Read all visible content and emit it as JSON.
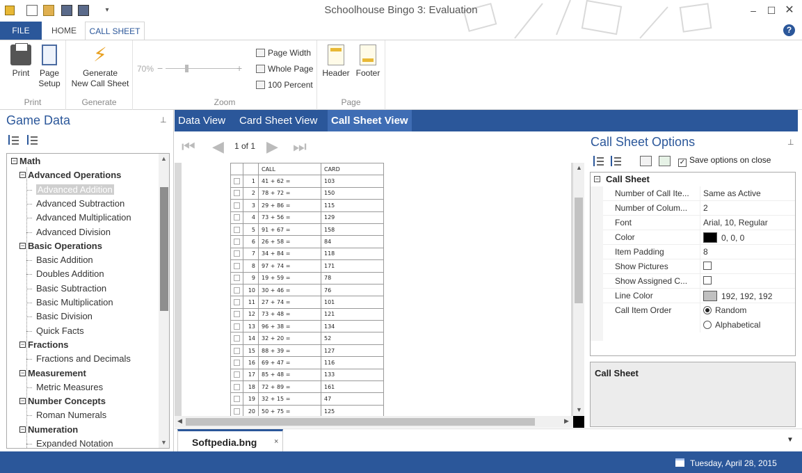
{
  "window": {
    "title": "Schoolhouse Bingo 3: Evaluation",
    "min_glyph": "–",
    "max_glyph": "☐",
    "close_glyph": "✕",
    "quick_more_glyph": "▾"
  },
  "menu": {
    "file": "FILE",
    "home": "HOME",
    "call_sheet": "CALL SHEET",
    "help": "?"
  },
  "ribbon": {
    "print_group": "Print",
    "print": "Print",
    "page_setup_1": "Page",
    "page_setup_2": "Setup",
    "generate_group": "Generate",
    "generate_1": "Generate",
    "generate_2": "New Call Sheet",
    "zoom_group": "Zoom",
    "zoom_pct": "70%",
    "zoom_minus": "−",
    "zoom_plus": "+",
    "page_width": "Page Width",
    "whole_page": "Whole Page",
    "hundred": "100 Percent",
    "page_group": "Page",
    "header": "Header",
    "footer": "Footer"
  },
  "game_data": {
    "title": "Game Data",
    "pin": "📌",
    "tree": [
      {
        "label": "Math",
        "level": 0
      },
      {
        "label": "Advanced Operations",
        "level": 1
      },
      {
        "label": "Advanced Addition",
        "level": 2,
        "selected": true
      },
      {
        "label": "Advanced Subtraction",
        "level": 2
      },
      {
        "label": "Advanced Multiplication",
        "level": 2
      },
      {
        "label": "Advanced Division",
        "level": 2
      },
      {
        "label": "Basic Operations",
        "level": 1
      },
      {
        "label": "Basic Addition",
        "level": 2
      },
      {
        "label": "Doubles Addition",
        "level": 2
      },
      {
        "label": "Basic Subtraction",
        "level": 2
      },
      {
        "label": "Basic Multiplication",
        "level": 2
      },
      {
        "label": "Basic Division",
        "level": 2
      },
      {
        "label": "Quick Facts",
        "level": 2
      },
      {
        "label": "Fractions",
        "level": 1
      },
      {
        "label": "Fractions and Decimals",
        "level": 2
      },
      {
        "label": "Measurement",
        "level": 1
      },
      {
        "label": "Metric Measures",
        "level": 2
      },
      {
        "label": "Number Concepts",
        "level": 1
      },
      {
        "label": "Roman Numerals",
        "level": 2
      },
      {
        "label": "Numeration",
        "level": 1
      },
      {
        "label": "Expanded Notation",
        "level": 2
      }
    ]
  },
  "view_tabs": {
    "data": "Data View",
    "card": "Card Sheet View",
    "call": "Call Sheet View"
  },
  "viewer": {
    "page_of": "1 of 1",
    "col_call": "CALL",
    "col_card": "CARD",
    "rows": [
      {
        "n": "1",
        "call": "41 + 62 =",
        "card": "103"
      },
      {
        "n": "2",
        "call": "78 + 72 =",
        "card": "150"
      },
      {
        "n": "3",
        "call": "29 + 86 =",
        "card": "115"
      },
      {
        "n": "4",
        "call": "73 + 56 =",
        "card": "129"
      },
      {
        "n": "5",
        "call": "91 + 67 =",
        "card": "158"
      },
      {
        "n": "6",
        "call": "26 + 58 =",
        "card": "84"
      },
      {
        "n": "7",
        "call": "34 + 84 =",
        "card": "118"
      },
      {
        "n": "8",
        "call": "97 + 74 =",
        "card": "171"
      },
      {
        "n": "9",
        "call": "19 + 59 =",
        "card": "78"
      },
      {
        "n": "10",
        "call": "30 + 46 =",
        "card": "76"
      },
      {
        "n": "11",
        "call": "27 + 74 =",
        "card": "101"
      },
      {
        "n": "12",
        "call": "73 + 48 =",
        "card": "121"
      },
      {
        "n": "13",
        "call": "96 + 38 =",
        "card": "134"
      },
      {
        "n": "14",
        "call": "32 + 20 =",
        "card": "52"
      },
      {
        "n": "15",
        "call": "88 + 39 =",
        "card": "127"
      },
      {
        "n": "16",
        "call": "69 + 47 =",
        "card": "116"
      },
      {
        "n": "17",
        "call": "85 + 48 =",
        "card": "133"
      },
      {
        "n": "18",
        "call": "72 + 89 =",
        "card": "161"
      },
      {
        "n": "19",
        "call": "32 + 15 =",
        "card": "47"
      },
      {
        "n": "20",
        "call": "50 + 75 =",
        "card": "125"
      }
    ]
  },
  "options": {
    "title": "Call Sheet Options",
    "save_on_close": "Save options on close",
    "save_on_close_checked": true,
    "section": "Call Sheet",
    "section_toggle": "⊟",
    "props": {
      "num_items_k": "Number of Call Ite...",
      "num_items_v": "Same as Active",
      "num_cols_k": "Number of Colum...",
      "num_cols_v": "2",
      "font_k": "Font",
      "font_v": "Arial, 10, Regular",
      "color_k": "Color",
      "color_v": "0, 0, 0",
      "color_hex": "#000000",
      "padding_k": "Item Padding",
      "padding_v": "8",
      "pictures_k": "Show Pictures",
      "assigned_k": "Show Assigned C...",
      "line_color_k": "Line Color",
      "line_color_v": "192, 192, 192",
      "line_color_hex": "#c0c0c0",
      "order_k": "Call Item Order",
      "order_random": "Random",
      "order_alpha": "Alphabetical"
    },
    "description_title": "Call Sheet"
  },
  "doc_tab": {
    "name": "Softpedia.bng",
    "close": "×",
    "menu": "▼"
  },
  "status": {
    "date": "Tuesday, April 28, 2015"
  },
  "colors": {
    "accent": "#2b579a"
  }
}
